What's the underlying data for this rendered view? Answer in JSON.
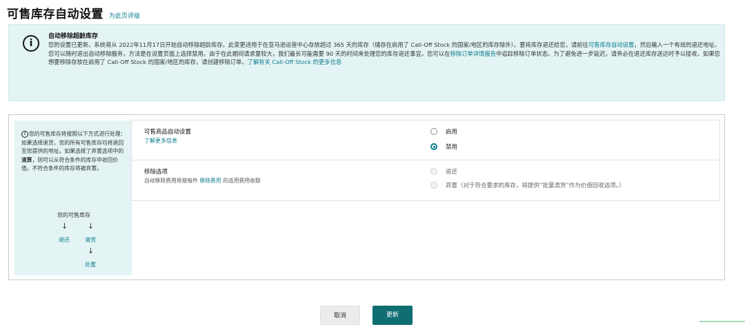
{
  "header": {
    "title": "可售库存自动设置",
    "feedback_link": "为此页评级"
  },
  "notice": {
    "icon": "info-icon",
    "title": "自动移除超龄库存",
    "body_1": "您的设置已更新。系统将从 2022年11月17日开始自动移除超龄库存。此变更适用于在亚马逊运营中心存放超过 365 天的库存（储存在启用了 Call-Off Stock 的国家/地区的库存除外）。要将库存退还给您，请前往",
    "link_1": "可售库存自动设置",
    "body_2": "，然后输入一个有效的退还地址。您可以随时退出自动移除服务，方法是在设置页面上选择禁用。由于在此期间请求量较大，我们最长可能需要 90 天的时间来处理您的库存退还事宜。您可以在",
    "link_2": "移除订单详情报告",
    "body_3": "中追踪移除订单状态。为了避免进一步延迟，请务必在退还库存送达时予以接收。如果您想要移除存放在启用了 Call-Off Stock 的国家/地区的库存，请创建移除订单。",
    "link_3": "了解有关 Call-Off Stock 的更多信息"
  },
  "sidebar": {
    "intro_1": "您的可售库存将按照以下方式进行处理：如果选择退货，您的所有可售库存均将退回至您提供的地址。如果选择了弃置选项中的",
    "intro_bold": "清算",
    "intro_2": "，则可以从符合条件的库存中收回价值。不符合条件的库存将被弃置。",
    "flow_title": "您的可售库存",
    "flow_return": "退还",
    "flow_liquidate": "清货",
    "flow_dispose": "处置",
    "arrow": "↓"
  },
  "settings": {
    "auto": {
      "label": "可售商品自动设置",
      "learn_more": "了解更多信息",
      "options": [
        {
          "label": "启用",
          "checked": false
        },
        {
          "label": "禁用",
          "checked": true
        }
      ]
    },
    "removal": {
      "label": "移除选项",
      "desc_1": "自动移除费用将按每件",
      "desc_link": "移除费用",
      "desc_2": "的适用费用收取",
      "options": [
        {
          "label": "退还",
          "enabled": false
        },
        {
          "label": "弃置（对于符合要求的库存，将提供“批量清货”作为价值回收选项。）",
          "enabled": false
        }
      ]
    }
  },
  "footer": {
    "cancel": "取消",
    "update": "更新"
  },
  "colors": {
    "accent": "#0a7b8c",
    "notice_bg": "#e4f4f4",
    "primary_button": "#0e6e72"
  }
}
